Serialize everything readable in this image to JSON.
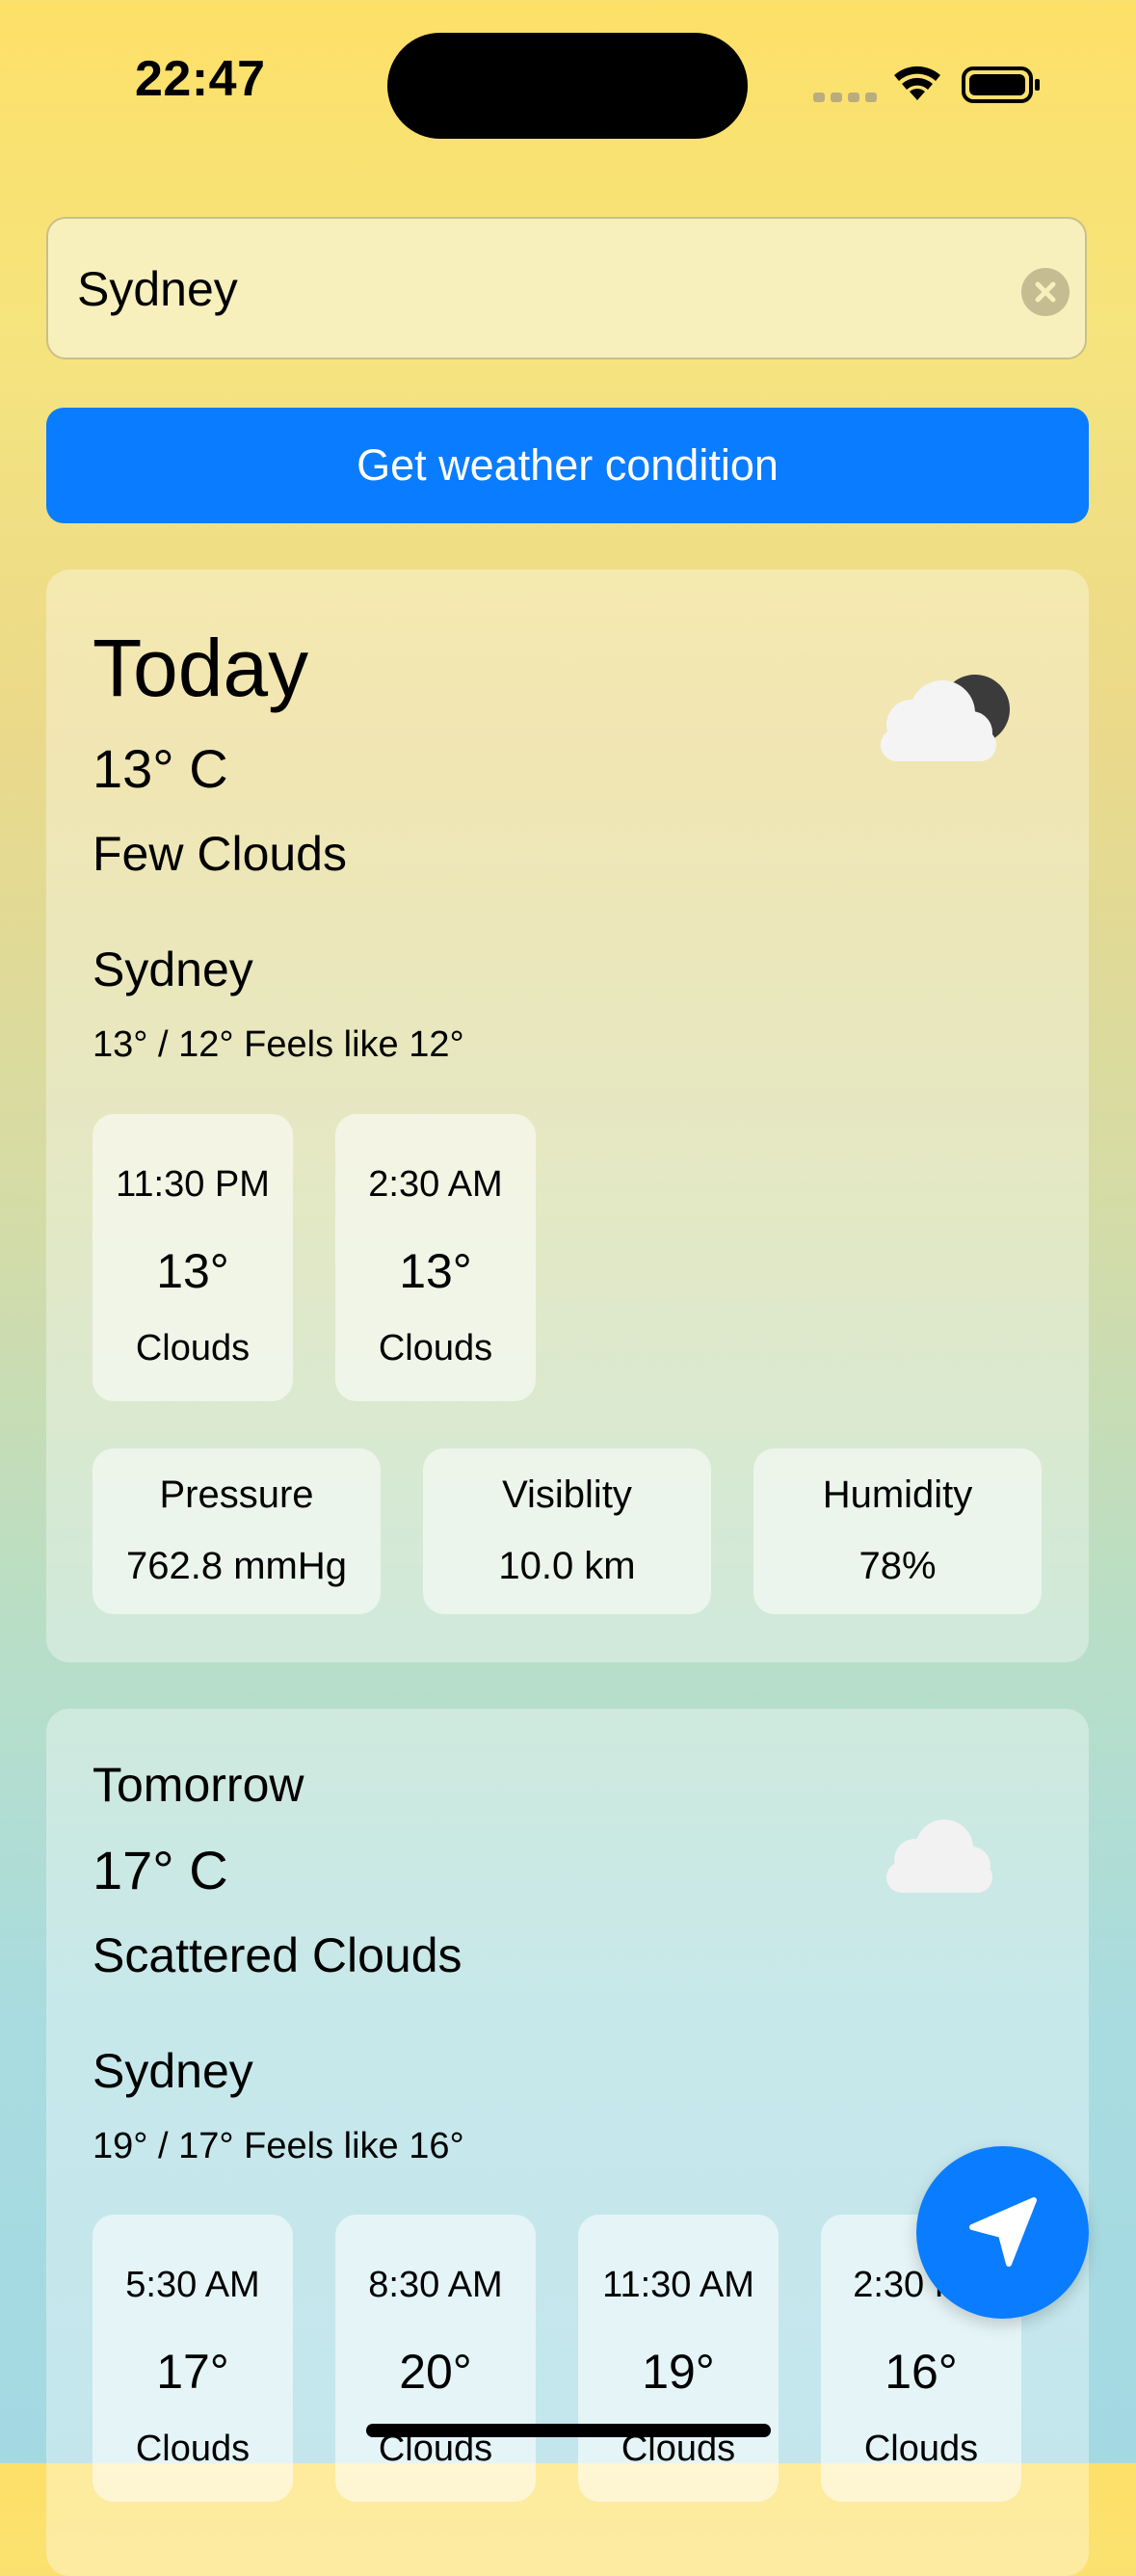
{
  "status_bar": {
    "time": "22:47"
  },
  "search": {
    "value": "Sydney"
  },
  "actions": {
    "get_weather_label": "Get weather condition"
  },
  "today": {
    "heading": "Today",
    "temperature": "13° C",
    "condition": "Few Clouds",
    "icon": "cloud-moon-icon",
    "city": "Sydney",
    "range": "13° / 12° Feels like 12°",
    "hourly": [
      {
        "time": "11:30 PM",
        "temp": "13°",
        "cond": "Clouds"
      },
      {
        "time": "2:30 AM",
        "temp": "13°",
        "cond": "Clouds"
      }
    ],
    "stats": [
      {
        "label": "Pressure",
        "value": "762.8 mmHg"
      },
      {
        "label": "Visiblity",
        "value": "10.0 km"
      },
      {
        "label": "Humidity",
        "value": "78%"
      }
    ]
  },
  "tomorrow": {
    "heading": "Tomorrow",
    "temperature": "17° C",
    "condition": "Scattered Clouds",
    "icon": "cloud-icon",
    "city": "Sydney",
    "range": "19° / 17° Feels like 16°",
    "hourly": [
      {
        "time": "5:30 AM",
        "temp": "17°",
        "cond": "Clouds"
      },
      {
        "time": "8:30 AM",
        "temp": "20°",
        "cond": "Clouds"
      },
      {
        "time": "11:30 AM",
        "temp": "19°",
        "cond": "Clouds"
      },
      {
        "time": "2:30 PM",
        "temp": "16°",
        "cond": "Clouds"
      }
    ]
  },
  "fab": {
    "icon": "location-arrow-icon"
  },
  "colors": {
    "accent": "#0A7CFF",
    "gradient_top": "#FDE068",
    "gradient_bottom": "#A4D9E4"
  }
}
